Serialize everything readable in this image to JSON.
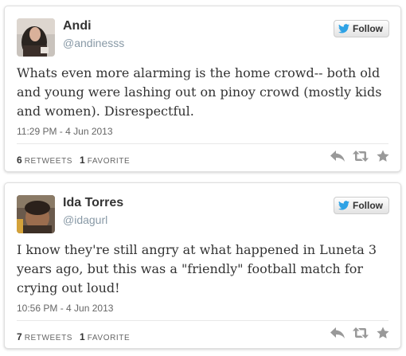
{
  "tweets": [
    {
      "name": "Andi",
      "handle": "@andinesss",
      "follow_label": "Follow",
      "text": "Whats even more alarming is the home crowd-- both old and young were lashing out on pinoy crowd (mostly kids and women). Disrespectful.",
      "timestamp": "11:29 PM - 4 Jun 2013",
      "retweets_count": "6",
      "retweets_label": "RETWEETS",
      "favorites_count": "1",
      "favorites_label": "FAVORITE",
      "icons": {
        "reply": "reply-icon",
        "retweet": "retweet-icon",
        "favorite": "star-icon"
      }
    },
    {
      "name": "Ida Torres",
      "handle": "@idagurl",
      "follow_label": "Follow",
      "text": "I know they're still angry at what happened in Luneta 3 years ago, but this was a \"friendly\" football match for crying out loud!",
      "timestamp": "10:56 PM - 4 Jun 2013",
      "retweets_count": "7",
      "retweets_label": "RETWEETS",
      "favorites_count": "1",
      "favorites_label": "FAVORITE",
      "icons": {
        "reply": "reply-icon",
        "retweet": "retweet-icon",
        "favorite": "star-icon"
      }
    }
  ],
  "colors": {
    "name": "#333333",
    "handle": "#8899a6",
    "twitter_blue": "#2ea2e5",
    "action_icons": "#999999"
  }
}
